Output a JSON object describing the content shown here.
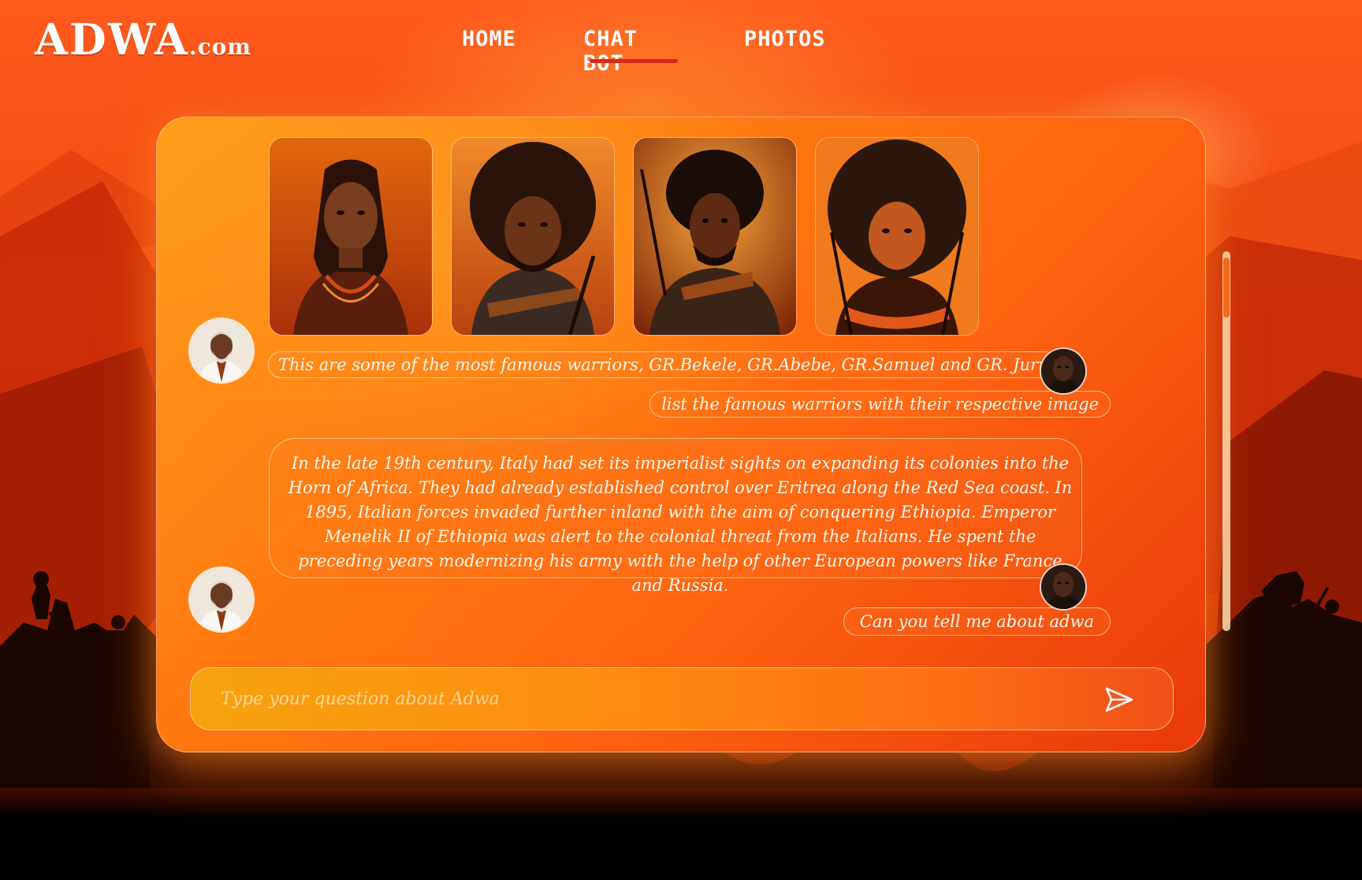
{
  "brand": {
    "name": "ADWA",
    "domain": ".com"
  },
  "nav": [
    {
      "label": "HOME",
      "active": false
    },
    {
      "label": "CHAT BOT",
      "active": true
    },
    {
      "label": "PHOTOS",
      "active": false
    }
  ],
  "colors": {
    "accent": "#d9281a",
    "primary": "#ff7a10",
    "text": "#ffffff"
  },
  "chat": {
    "gallery": [
      {
        "name": "warrior-portrait-1"
      },
      {
        "name": "warrior-portrait-2"
      },
      {
        "name": "warrior-portrait-3"
      },
      {
        "name": "warrior-portrait-4"
      }
    ],
    "messages": {
      "warriors_reply": "This are some of the most famous warriors, GR.Bekele, GR.Abebe, GR.Samuel and GR. Juru",
      "list_request": "list the famous warriors with their respective image",
      "adwa_reply": "In the late 19th century, Italy had set its imperialist sights on expanding its colonies into the Horn of Africa. They had already established control over Eritrea along the Red Sea coast. In 1895, Italian forces invaded further inland with the aim of conquering Ethiopia. Emperor Menelik II of Ethiopia was alert to the colonial threat from the Italians. He spent the preceding years modernizing his army with the help of other European powers like France and Russia.",
      "adwa_request": "Can you tell me about adwa"
    },
    "bot_avatar": "elder-avatar",
    "user_avatar": "user-avatar",
    "input": {
      "placeholder": "Type your question about Adwa",
      "value": ""
    },
    "send_icon": "send-icon",
    "scroll_position": 0.0
  }
}
